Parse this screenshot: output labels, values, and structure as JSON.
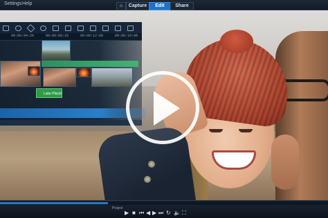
{
  "menu": {
    "settings": "Settings",
    "help": "Help"
  },
  "tabs": [
    {
      "label": "Capture",
      "active": false
    },
    {
      "label": "Edit",
      "active": true
    },
    {
      "label": "Share",
      "active": false
    }
  ],
  "home_icon": "home-icon",
  "accent_color": "#1e73c9",
  "timeline": {
    "timecodes": [
      "00:00:04:20",
      "00:00:08:16",
      "00:00:12:08",
      "00:00:16:00"
    ],
    "title_clip_label": "Lake Placid"
  },
  "playback": {
    "mode_label": "Project",
    "progress_fraction": 0.33
  },
  "icons": [
    "play-icon",
    "undo-icon",
    "redo-icon",
    "fast-forward-icon",
    "volume-icon",
    "fullscreen-icon"
  ]
}
